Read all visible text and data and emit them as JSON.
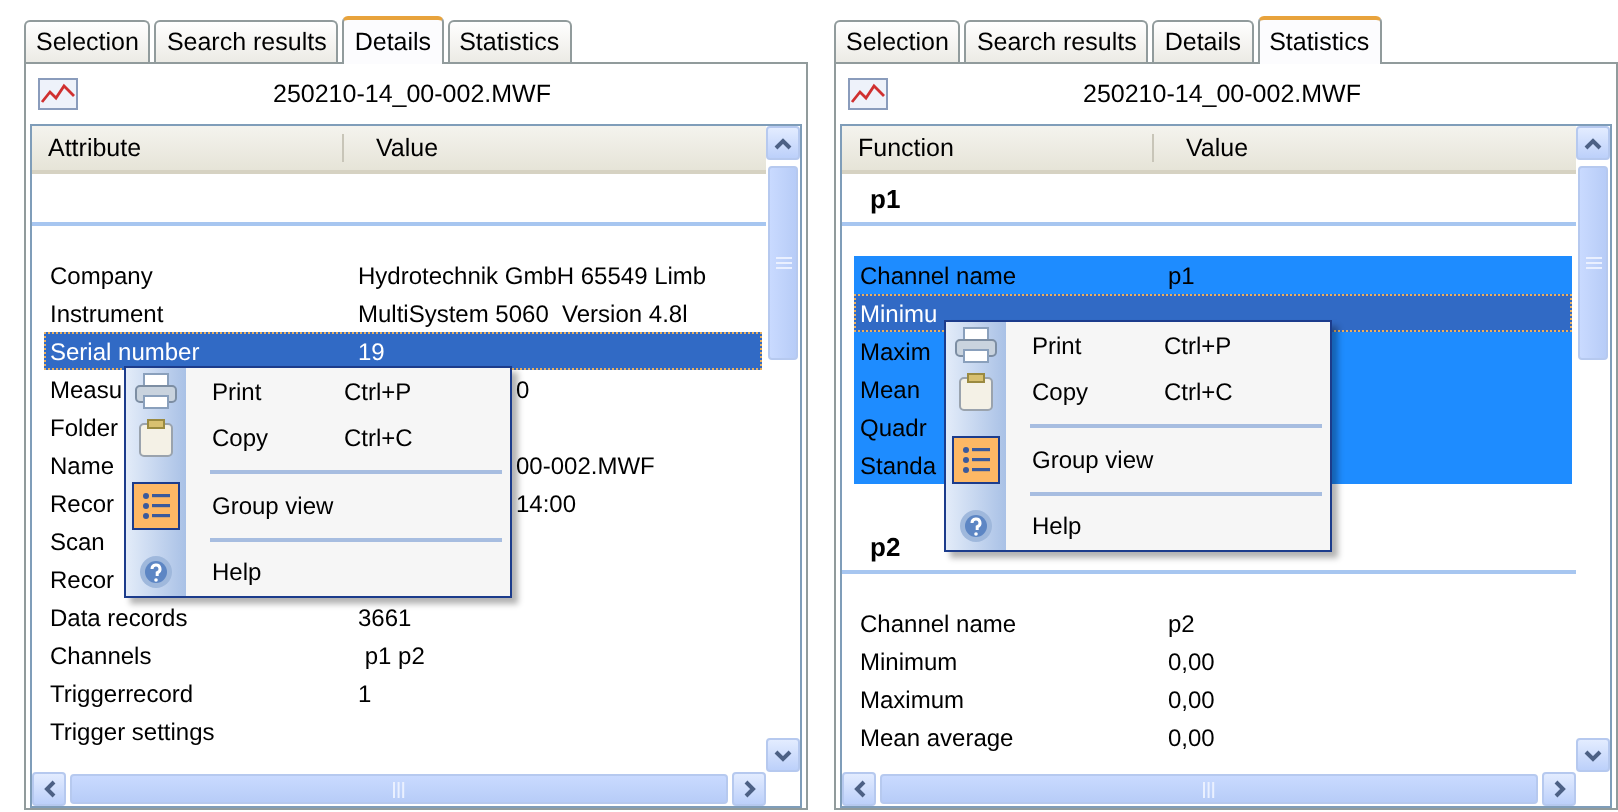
{
  "panels": [
    {
      "tabs": [
        {
          "label": "Selection",
          "selected": false
        },
        {
          "label": "Search results",
          "selected": false
        },
        {
          "label": "Details",
          "selected": true
        },
        {
          "label": "Statistics",
          "selected": false
        }
      ],
      "file_name": "250210-14_00-002.MWF",
      "columns": [
        "Attribute",
        "Value"
      ],
      "groups": [
        {
          "rows": [
            {
              "kind": "full",
              "attribute": "Company",
              "value": "Hydrotechnik GmbH 65549 Limb",
              "selected": false,
              "focused": false
            },
            {
              "kind": "full",
              "attribute": "Instrument",
              "value": "MultiSystem 5060  Version 4.8l",
              "selected": false,
              "focused": false
            },
            {
              "kind": "full",
              "attribute": "Serial number",
              "value": "19",
              "selected": true,
              "focused": true
            },
            {
              "kind": "covered",
              "attribute": "Measu",
              "value": "0",
              "selected": false,
              "focused": false
            },
            {
              "kind": "covered",
              "attribute": "Folder",
              "selected": false,
              "focused": false
            },
            {
              "kind": "covered",
              "attribute": "Name",
              "value": "00-002.MWF",
              "selected": false,
              "focused": false
            },
            {
              "kind": "covered",
              "attribute": "Recor",
              "value": "14:00",
              "selected": false,
              "focused": false
            },
            {
              "kind": "covered",
              "attribute": "Scan",
              "selected": false,
              "focused": false
            },
            {
              "kind": "covered",
              "attribute": "Recor",
              "selected": false,
              "focused": false
            },
            {
              "kind": "full",
              "attribute": "Data records",
              "value": "3661",
              "selected": false,
              "focused": false
            },
            {
              "kind": "full",
              "attribute": "Channels",
              "value": " p1 p2",
              "selected": false,
              "focused": false
            },
            {
              "kind": "full",
              "attribute": "Triggerrecord",
              "value": "1",
              "selected": false,
              "focused": false
            },
            {
              "kind": "full",
              "attribute": "Trigger settings",
              "selected": false,
              "focused": false
            }
          ]
        }
      ],
      "context_menu": {
        "items": [
          {
            "kind": "command",
            "label": "Print",
            "shortcut": "Ctrl+P",
            "checked": false
          },
          {
            "kind": "command",
            "label": "Copy",
            "shortcut": "Ctrl+C",
            "checked": false
          },
          {
            "kind": "separator"
          },
          {
            "kind": "command",
            "label": "Group view",
            "checked": true
          },
          {
            "kind": "separator"
          },
          {
            "kind": "command",
            "label": "Help",
            "checked": false
          }
        ]
      }
    },
    {
      "tabs": [
        {
          "label": "Selection",
          "selected": false
        },
        {
          "label": "Search results",
          "selected": false
        },
        {
          "label": "Details",
          "selected": false
        },
        {
          "label": "Statistics",
          "selected": true
        }
      ],
      "file_name": "250210-14_00-002.MWF",
      "columns": [
        "Function",
        "Value"
      ],
      "groups": [
        {
          "title": "p1",
          "rows": [
            {
              "kind": "full",
              "attribute": "Channel name",
              "value": "p1",
              "selected": true,
              "focused": false
            },
            {
              "kind": "covered",
              "attribute": "Minimu",
              "selected": true,
              "focused": true
            },
            {
              "kind": "covered",
              "attribute": "Maxim",
              "selected": true,
              "focused": false
            },
            {
              "kind": "covered",
              "attribute": "Mean",
              "selected": true,
              "focused": false
            },
            {
              "kind": "covered",
              "attribute": "Quadr",
              "selected": true,
              "focused": false
            },
            {
              "kind": "covered",
              "attribute": "Standa",
              "selected": true,
              "focused": false
            }
          ]
        },
        {
          "title": "p2",
          "rows": [
            {
              "kind": "full",
              "attribute": "Channel name",
              "value": "p2",
              "selected": false,
              "focused": false
            },
            {
              "kind": "full",
              "attribute": "Minimum",
              "value": "0,00",
              "selected": false,
              "focused": false
            },
            {
              "kind": "full",
              "attribute": "Maximum",
              "value": "0,00",
              "selected": false,
              "focused": false
            },
            {
              "kind": "full",
              "attribute": "Mean average",
              "value": "0,00",
              "selected": false,
              "focused": false
            }
          ]
        }
      ],
      "context_menu": {
        "items": [
          {
            "kind": "command",
            "label": "Print",
            "shortcut": "Ctrl+P",
            "checked": false
          },
          {
            "kind": "command",
            "label": "Copy",
            "shortcut": "Ctrl+C",
            "checked": false
          },
          {
            "kind": "separator"
          },
          {
            "kind": "command",
            "label": "Group view",
            "checked": true
          },
          {
            "kind": "separator"
          },
          {
            "kind": "command",
            "label": "Help",
            "checked": false
          }
        ]
      }
    }
  ]
}
